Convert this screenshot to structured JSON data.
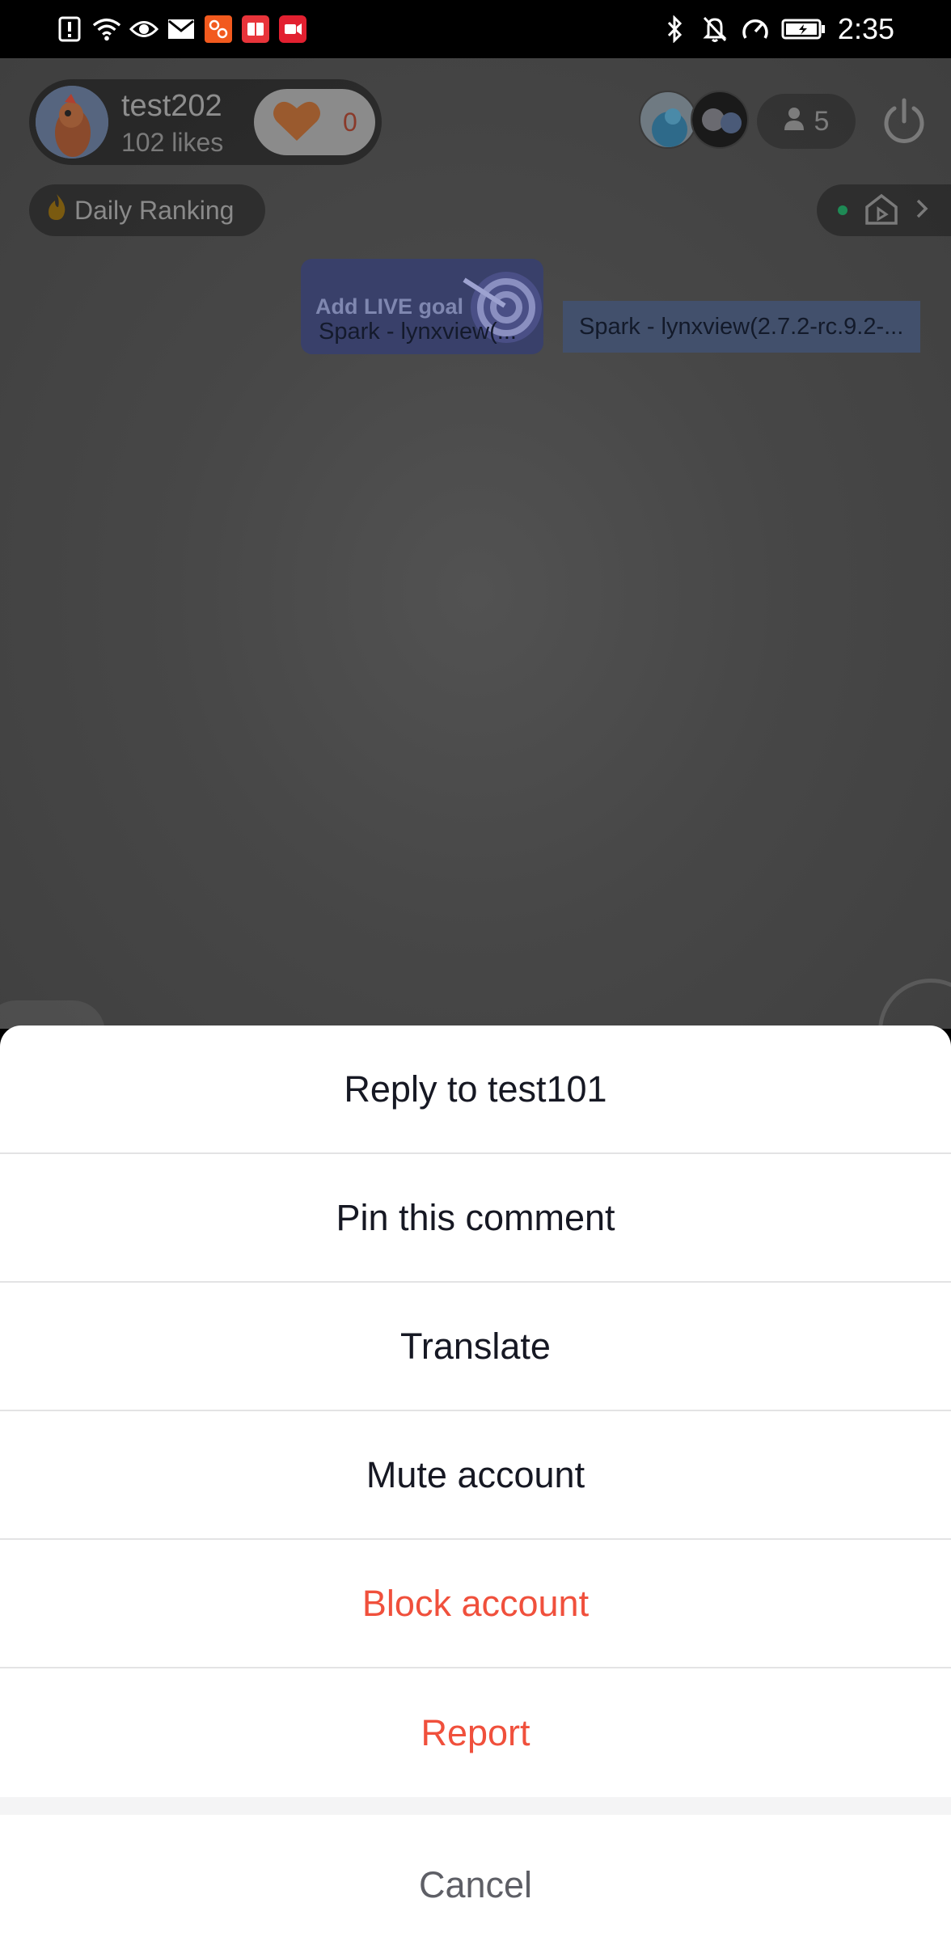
{
  "status_bar": {
    "time": "2:35",
    "left_icons": [
      "alert-icon",
      "wifi-icon",
      "eye-icon",
      "mail-icon",
      "app-orange-icon",
      "app-red-book-icon",
      "video-camera-icon"
    ],
    "right_icons": [
      "bluetooth-icon",
      "bell-off-icon",
      "speedometer-icon",
      "battery-icon"
    ]
  },
  "live": {
    "host_name": "test202",
    "host_likes": "102 likes",
    "like_count": "0",
    "viewer_count": "5",
    "daily_ranking": "Daily Ranking",
    "goal_title": "Add LIVE goal",
    "goal_spark": "Spark - lynxview(...",
    "spark_text": "Spark - lynxview(2.7.2-rc.9.2-..."
  },
  "sheet": {
    "items": [
      {
        "label": "Reply to test101",
        "style": "normal"
      },
      {
        "label": "Pin this comment",
        "style": "normal"
      },
      {
        "label": "Translate",
        "style": "normal"
      },
      {
        "label": "Mute account",
        "style": "normal"
      },
      {
        "label": "Block account",
        "style": "danger"
      },
      {
        "label": "Report",
        "style": "danger"
      }
    ],
    "cancel": "Cancel"
  },
  "colors": {
    "danger": "#f0503c",
    "text": "#161823",
    "cancel": "#5e5f66"
  }
}
